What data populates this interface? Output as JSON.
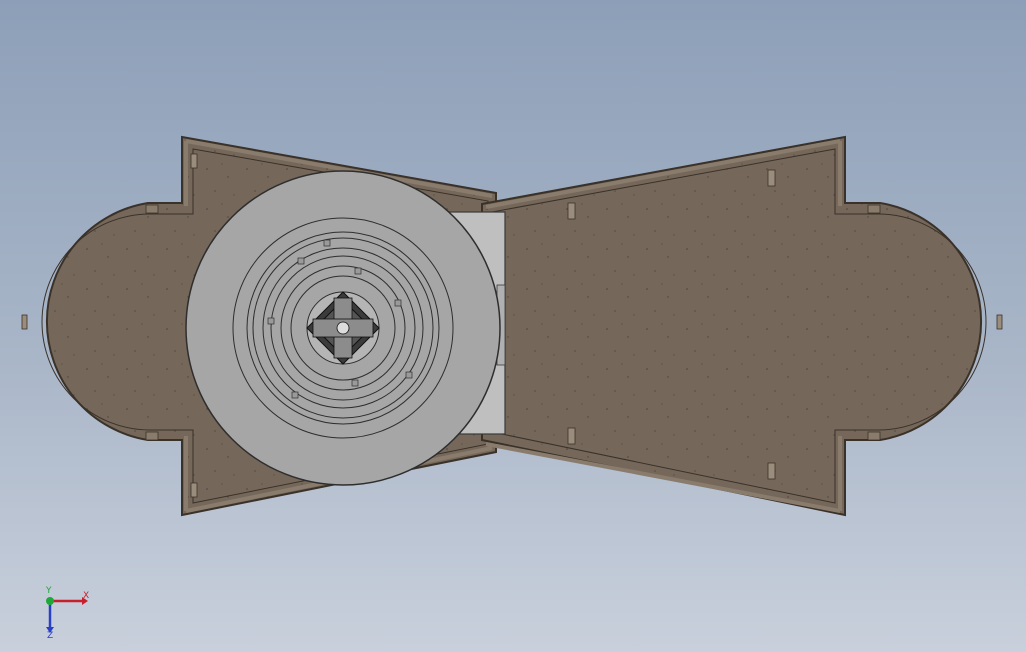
{
  "viewport": {
    "background_top": "#8d9fb8",
    "background_bottom": "#c9d0dc"
  },
  "model": {
    "base_color": "#75685a",
    "edge_color": "#3a3129",
    "wall_color": "#8a7c6c",
    "cylinder_color": "#a6a6a6",
    "mount_color": "#bfbfbf"
  },
  "triad": {
    "x_label": "X",
    "y_label": "Y",
    "z_label": "Z",
    "x_color": "#c8202a",
    "y_color": "#1ea83a",
    "z_color": "#2a3fc8"
  }
}
